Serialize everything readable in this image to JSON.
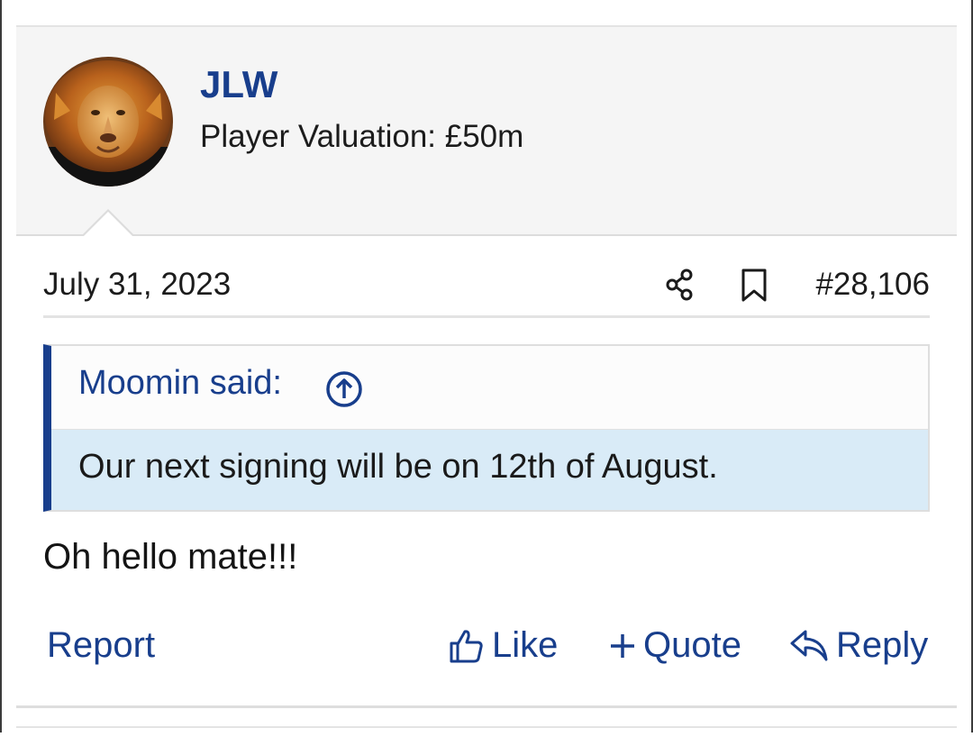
{
  "post": {
    "username": "JLW",
    "user_title": "Player Valuation: £50m",
    "avatar_icon": "lion-avatar",
    "date": "July 31, 2023",
    "post_number": "#28,106",
    "share_icon": "share-icon",
    "bookmark_icon": "bookmark-icon",
    "quote": {
      "author_line": "Moomin said:",
      "jump_icon": "arrow-up-circle-icon",
      "text": "Our next signing will be on 12th of August."
    },
    "message": "Oh hello mate!!!",
    "actions": {
      "report": "Report",
      "like": "Like",
      "quote": "Quote",
      "reply": "Reply"
    }
  },
  "colors": {
    "accent": "#183e8c",
    "quote_bg": "#d9ebf7",
    "user_block_bg": "#f5f5f5"
  }
}
